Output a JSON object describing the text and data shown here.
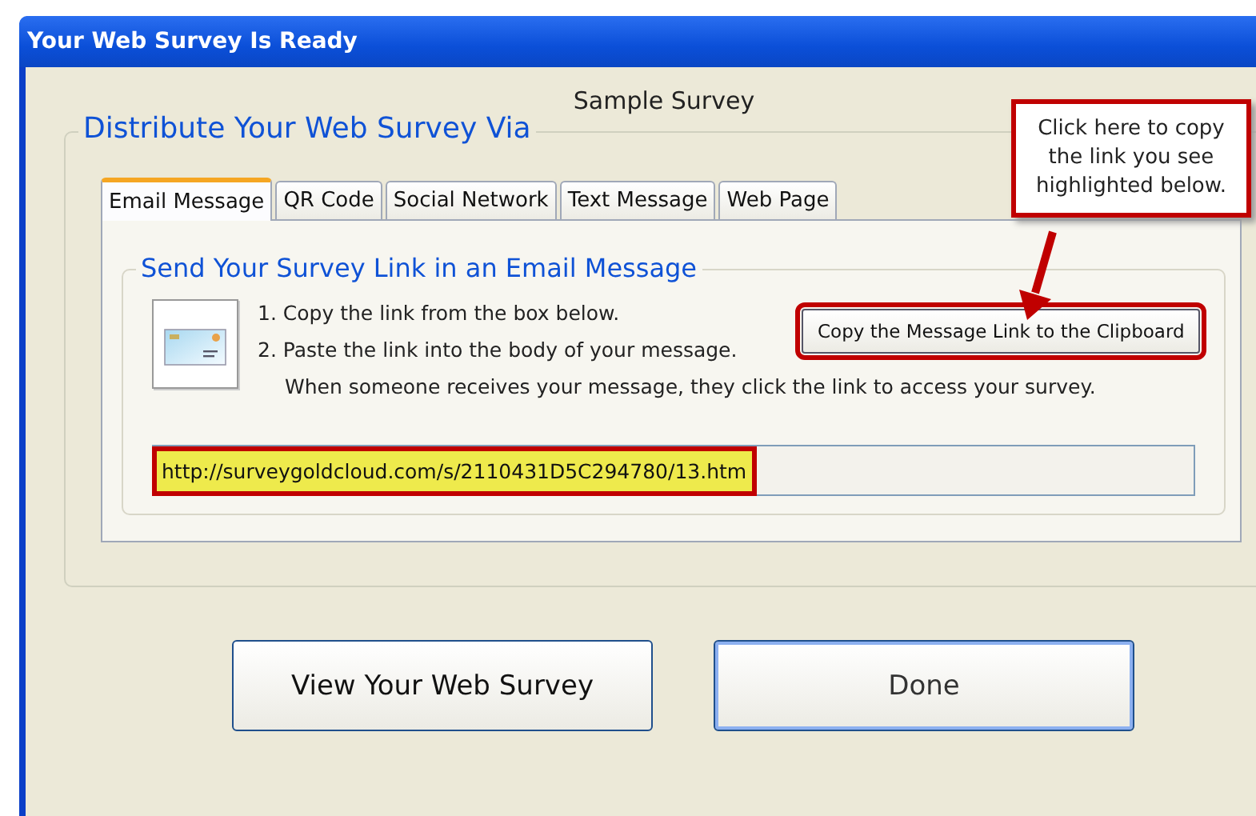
{
  "window": {
    "title": "Your Web Survey Is Ready"
  },
  "survey_name": "Sample Survey",
  "group_title": "Distribute Your Web Survey Via",
  "tabs": [
    {
      "label": "Email Message",
      "selected": true
    },
    {
      "label": "QR Code",
      "selected": false
    },
    {
      "label": "Social Network",
      "selected": false
    },
    {
      "label": "Text Message",
      "selected": false
    },
    {
      "label": "Web Page",
      "selected": false
    }
  ],
  "section_title": "Send Your Survey Link in an Email Message",
  "steps": [
    "1. Copy the link from the box below.",
    "2. Paste the link into the body of your message.",
    "When someone receives your message, they click the link to access your survey."
  ],
  "copy_button": "Copy the Message Link to the Clipboard",
  "link": {
    "value": "http://surveygoldcloud.com/s/2110431D5C294780/13.htm"
  },
  "callout": "Click here to copy the link you see highlighted below.",
  "buttons": [
    {
      "label": "View Your Web Survey",
      "default": false
    },
    {
      "label": "Done",
      "default": true
    }
  ]
}
